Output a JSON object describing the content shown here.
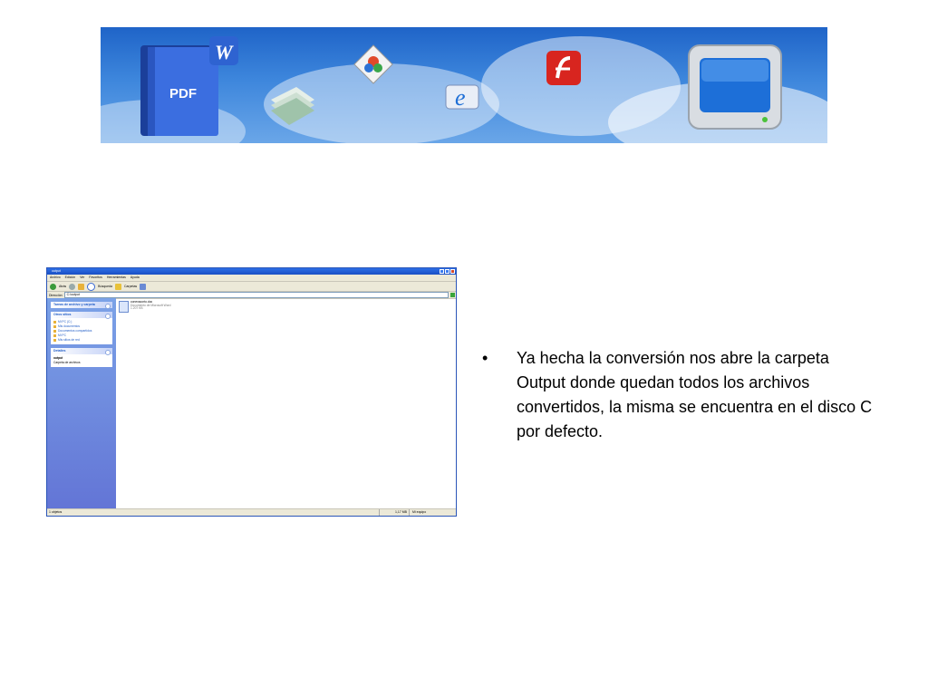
{
  "banner": {
    "pdf_label": "PDF",
    "word_letter": "W"
  },
  "window": {
    "title": "output",
    "menu": [
      "Archivo",
      "Edición",
      "Ver",
      "Favoritos",
      "Herramientas",
      "Ayuda"
    ],
    "toolbar": {
      "back": "Atrás",
      "search": "Búsqueda",
      "folders": "Carpetas"
    },
    "address": {
      "label": "Dirección",
      "value": "C:\\output"
    },
    "panels": {
      "tasks": {
        "title": "Tareas de archivo y carpeta"
      },
      "places": {
        "title": "Otros sitios",
        "items": [
          "Mi PC (C:)",
          "Mis documentos",
          "Documentos compartidos",
          "Mi PC",
          "Mis sitios de red"
        ]
      },
      "details": {
        "title": "Detalles",
        "name": "output",
        "type": "Carpeta de archivos"
      }
    },
    "file": {
      "name": "conexacorto.doc",
      "type": "Documento de Microsoft Word",
      "size": "1.207 KB"
    },
    "status": {
      "objects": "1 objetos",
      "size": "1,17 MB",
      "zone": "Mi equipo"
    }
  },
  "bullet_text": "Ya hecha la conversión nos abre la carpeta Output donde quedan todos los archivos convertidos, la misma se encuentra en el disco C  por defecto."
}
